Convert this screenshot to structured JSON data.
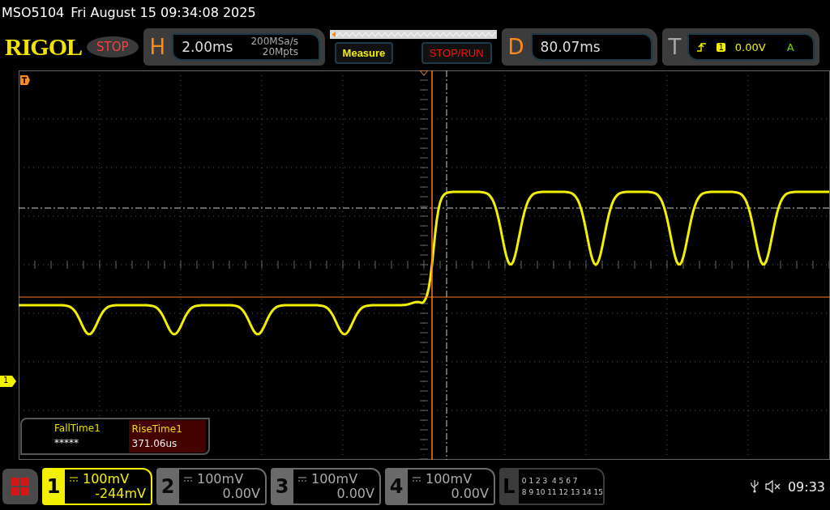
{
  "title_bar": {
    "model": "MSO5104",
    "datetime": "Fri August 15 09:34:08 2025"
  },
  "toolbar": {
    "logo": "RIGOL",
    "run_state": "STOP",
    "horizontal": {
      "letter": "H",
      "timebase": "2.00ms",
      "sample_rate": "200MSa/s",
      "memory_depth": "20Mpts"
    },
    "buttons": [
      {
        "label": "Measure",
        "kind": "measure"
      },
      {
        "label": "STOP/RUN",
        "kind": "stoprun"
      }
    ],
    "delay": {
      "letter": "D",
      "value": "80.07ms"
    },
    "trigger": {
      "letter": "T",
      "source": "1",
      "level": "0.00V",
      "mode": "A"
    }
  },
  "ground_marker": {
    "label": "1"
  },
  "measurements": [
    {
      "name": "FallTime1",
      "value": "*****",
      "selected": false
    },
    {
      "name": "RiseTime1",
      "value": "371.06us",
      "selected": true
    }
  ],
  "channels": [
    {
      "number": "1",
      "scale": "100mV",
      "offset": "-244mV",
      "on": true
    },
    {
      "number": "2",
      "scale": "100mV",
      "offset": "0.00V",
      "on": false
    },
    {
      "number": "3",
      "scale": "100mV",
      "offset": "0.00V",
      "on": false
    },
    {
      "number": "4",
      "scale": "100mV",
      "offset": "0.00V",
      "on": false
    }
  ],
  "logic": {
    "letter": "L",
    "row_1": "0 1 2 3  4 5 6 7",
    "row_2": "8 9 10 11 12 13 14 15"
  },
  "status": {
    "time": "09:33"
  }
}
